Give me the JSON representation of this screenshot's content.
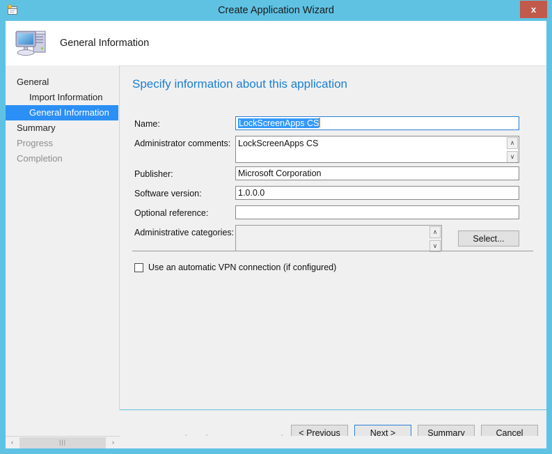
{
  "window": {
    "title": "Create Application Wizard",
    "title_icon": "wizard-app-icon",
    "close_label": "x",
    "accent_cyan": "#5fc2e3",
    "close_red": "#c15a4a"
  },
  "header": {
    "icon": "computer-icon",
    "title": "General Information"
  },
  "sidebar": {
    "items": [
      {
        "label": "General",
        "level": 0,
        "state": "normal"
      },
      {
        "label": "Import Information",
        "level": 1,
        "state": "normal"
      },
      {
        "label": "General Information",
        "level": 1,
        "state": "selected"
      },
      {
        "label": "Summary",
        "level": 0,
        "state": "normal"
      },
      {
        "label": "Progress",
        "level": 0,
        "state": "disabled"
      },
      {
        "label": "Completion",
        "level": 0,
        "state": "disabled"
      }
    ],
    "selected_color": "#2b8ff5",
    "scrollbar": {
      "left_arrow": "‹",
      "right_arrow": "›",
      "thumb_grip": "|||"
    }
  },
  "content": {
    "heading": "Specify information about this application",
    "heading_color": "#1a7fd4",
    "fields": {
      "name": {
        "label": "Name:",
        "value": "LockScreenApps CS",
        "selected": true,
        "focused": true,
        "placeholder": ""
      },
      "admin_comments": {
        "label": "Administrator comments:",
        "value": "LockScreenApps CS",
        "placeholder": ""
      },
      "publisher": {
        "label": "Publisher:",
        "value": "Microsoft Corporation",
        "placeholder": ""
      },
      "software_version": {
        "label": "Software version:",
        "value": "1.0.0.0",
        "placeholder": ""
      },
      "optional_reference": {
        "label": "Optional reference:",
        "value": "",
        "placeholder": ""
      },
      "admin_categories": {
        "label": "Administrative categories:",
        "value": "",
        "select_button": "Select..."
      }
    },
    "vpn_checkbox": {
      "label": "Use an automatic VPN connection (if configured)",
      "checked": false
    },
    "scroll_arrows": {
      "up": "∧",
      "down": "∨"
    }
  },
  "footer": {
    "buttons": {
      "previous": "< Previous",
      "next": "Next >",
      "summary": "Summary",
      "cancel": "Cancel"
    },
    "focused_button": "next"
  },
  "watermark": {
    "text": "windows-noob.com"
  }
}
